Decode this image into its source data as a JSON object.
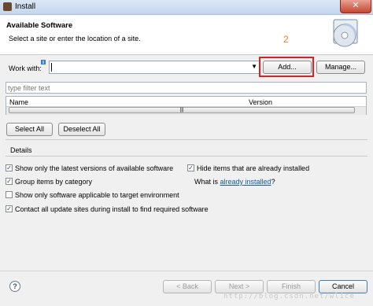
{
  "window": {
    "title": "Install",
    "close_glyph": "✕"
  },
  "header": {
    "title": "Available Software",
    "description": "Select a site or enter the location of a site.",
    "annotation": "2",
    "icon": "cd-install-icon"
  },
  "work_with": {
    "label": "Work with:",
    "value": "",
    "add_label": "Add...",
    "manage_label": "Manage..."
  },
  "filter": {
    "placeholder": "type filter text"
  },
  "table": {
    "columns": [
      "Name",
      "Version"
    ],
    "scroll_glyph": "|||"
  },
  "selection_buttons": {
    "select_all": "Select All",
    "deselect_all": "Deselect All"
  },
  "details": {
    "label": "Details"
  },
  "options": {
    "latest_versions": {
      "label": "Show only the latest versions of available software",
      "checked": true
    },
    "hide_installed": {
      "label": "Hide items that are already installed",
      "checked": true
    },
    "group_by_category": {
      "label": "Group items by category",
      "checked": true
    },
    "what_is": {
      "prefix": "What is ",
      "link": "already installed",
      "suffix": "?"
    },
    "applicable_only": {
      "label": "Show only software applicable to target environment",
      "checked": false
    },
    "contact_sites": {
      "label": "Contact all update sites during install to find required software",
      "checked": true
    }
  },
  "footer": {
    "help_glyph": "?",
    "back": "< Back",
    "next": "Next >",
    "finish": "Finish",
    "cancel": "Cancel",
    "watermark": "http://blog.csdn.net/wlice"
  }
}
